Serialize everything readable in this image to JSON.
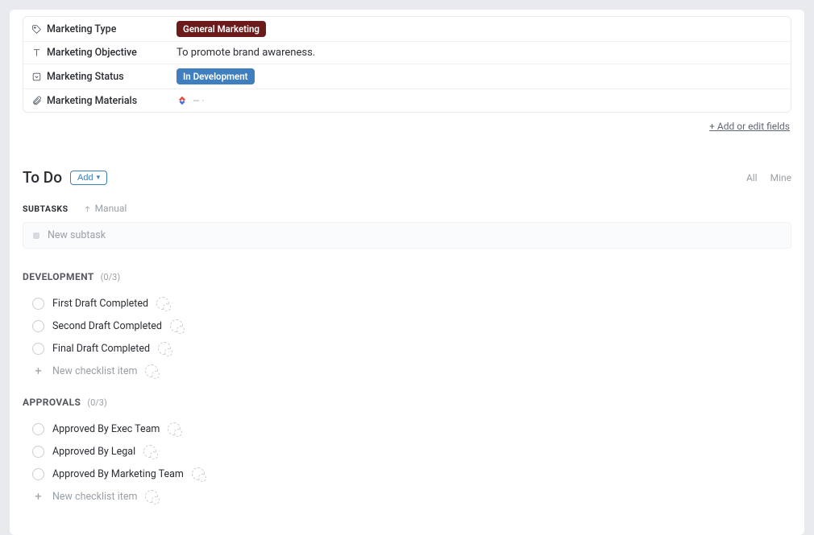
{
  "fields": {
    "type": {
      "label": "Marketing Type",
      "value": "General Marketing"
    },
    "objective": {
      "label": "Marketing Objective",
      "value": "To promote brand awareness."
    },
    "status": {
      "label": "Marketing Status",
      "value": "In Development"
    },
    "materials": {
      "label": "Marketing Materials",
      "value": "— ·"
    }
  },
  "fields_footer": "+ Add or edit fields",
  "todo": {
    "title": "To Do",
    "add_label": "Add",
    "filters": {
      "all": "All",
      "mine": "Mine"
    }
  },
  "subtasks": {
    "label": "SUBTASKS",
    "sort_label": "Manual",
    "placeholder": "New subtask"
  },
  "checklists": [
    {
      "title": "DEVELOPMENT",
      "count": "(0/3)",
      "items": [
        "First Draft Completed",
        "Second Draft Completed",
        "Final Draft Completed"
      ],
      "new_item": "New checklist item"
    },
    {
      "title": "APPROVALS",
      "count": "(0/3)",
      "items": [
        "Approved By Exec Team",
        "Approved By Legal",
        "Approved By Marketing Team"
      ],
      "new_item": "New checklist item"
    }
  ]
}
